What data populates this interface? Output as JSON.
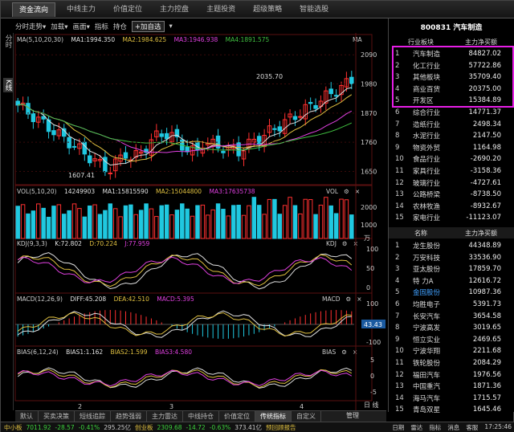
{
  "top_tabs": [
    "资金流向",
    "中线主力",
    "价值定位",
    "主力控盘",
    "主题投资",
    "超级策略",
    "智能选股"
  ],
  "active_top_tab": 0,
  "toolbar": {
    "items": [
      "分时走势▾",
      "加载▾",
      "画面▾",
      "指标",
      "持仓"
    ],
    "add_watch": "+加自选",
    "add_watch_arrow": "▾",
    "right_label": "MA"
  },
  "left_vertical": {
    "top": "分时",
    "middle": "K线"
  },
  "ma_legend": {
    "name": "MA(5,10,20,30)",
    "items": [
      {
        "label": "MA1:1994.350",
        "color": "#e0e0e0"
      },
      {
        "label": "MA2:1984.625",
        "color": "#e0c040"
      },
      {
        "label": "MA3:1946.938",
        "color": "#e040e0"
      },
      {
        "label": "MA4:1891.575",
        "color": "#40c040"
      }
    ]
  },
  "price_axis": {
    "labels": [
      "2090",
      "1980",
      "1870",
      "1760",
      "1650"
    ],
    "min": 1600,
    "max": 2130
  },
  "price_annotations": {
    "high": "2035.70",
    "low": "1607.41"
  },
  "vol_legend": {
    "name": "VOL(5,10,20)",
    "items": [
      {
        "label": "14249903",
        "color": "#e0e0e0"
      },
      {
        "label": "MA1:15815590",
        "color": "#e0e0e0"
      },
      {
        "label": "MA2:15044800",
        "color": "#e0c040"
      },
      {
        "label": "MA3:17635738",
        "color": "#e040e0"
      }
    ],
    "tag": "VOL"
  },
  "vol_axis": {
    "labels": [
      "2000",
      "1000"
    ],
    "unit": "万"
  },
  "kdj_legend": {
    "name": "KDJ(9,3,3)",
    "items": [
      {
        "label": "K:72.802",
        "color": "#e0e0e0"
      },
      {
        "label": "D:70.224",
        "color": "#e0c040"
      },
      {
        "label": "J:77.959",
        "color": "#e040e0"
      }
    ],
    "tag": "KDJ"
  },
  "kdj_axis": {
    "labels": [
      "100",
      "50",
      "0"
    ]
  },
  "macd_legend": {
    "name": "MACD(12,26,9)",
    "items": [
      {
        "label": "DIFF:45.208",
        "color": "#e0e0e0"
      },
      {
        "label": "DEA:42.510",
        "color": "#e0c040"
      },
      {
        "label": "MACD:5.395",
        "color": "#e040e0"
      }
    ],
    "tag": "MACD"
  },
  "macd_axis": {
    "labels": [
      "100",
      "-100"
    ],
    "badge": "43.43"
  },
  "bias_legend": {
    "name": "BIAS(6,12,24)",
    "items": [
      {
        "label": "BIAS1:1.162",
        "color": "#e0e0e0"
      },
      {
        "label": "BIAS2:1.599",
        "color": "#e0c040"
      },
      {
        "label": "BIAS3:4.580",
        "color": "#e040e0"
      }
    ],
    "tag": "BIAS"
  },
  "bias_axis": {
    "labels": [
      "5",
      "0",
      "-5"
    ]
  },
  "date_axis": [
    "2",
    "3",
    "4"
  ],
  "right_panel": {
    "title": "800831 汽车制造",
    "sector_headers": [
      "行业板块",
      "主力净买额"
    ],
    "sectors": [
      {
        "rank": "1",
        "name": "汽车制造",
        "value": "84827.02"
      },
      {
        "rank": "2",
        "name": "化工行业",
        "value": "57722.86"
      },
      {
        "rank": "3",
        "name": "其他板块",
        "value": "35709.40"
      },
      {
        "rank": "4",
        "name": "商业百货",
        "value": "20375.00"
      },
      {
        "rank": "5",
        "name": "开发区",
        "value": "15384.89"
      },
      {
        "rank": "6",
        "name": "综合行业",
        "value": "14771.37"
      },
      {
        "rank": "7",
        "name": "造纸行业",
        "value": "2498.34"
      },
      {
        "rank": "8",
        "name": "水泥行业",
        "value": "2147.50"
      },
      {
        "rank": "9",
        "name": "物资外贸",
        "value": "1164.98"
      },
      {
        "rank": "10",
        "name": "食品行业",
        "value": "-2690.20"
      },
      {
        "rank": "11",
        "name": "家具行业",
        "value": "-3158.36"
      },
      {
        "rank": "12",
        "name": "玻璃行业",
        "value": "-4727.61"
      },
      {
        "rank": "13",
        "name": "公路桥梁",
        "value": "-8738.50"
      },
      {
        "rank": "14",
        "name": "农林牧渔",
        "value": "-8932.67"
      },
      {
        "rank": "15",
        "name": "家电行业",
        "value": "-11123.07"
      }
    ],
    "stock_headers": [
      "名称",
      "主力净买额"
    ],
    "stocks": [
      {
        "rank": "1",
        "name": "龙生股份",
        "value": "44348.89"
      },
      {
        "rank": "2",
        "name": "万安科技",
        "value": "33536.90"
      },
      {
        "rank": "3",
        "name": "亚太股份",
        "value": "17859.70"
      },
      {
        "rank": "4",
        "name": "特 力A",
        "value": "12616.72"
      },
      {
        "rank": "5",
        "name": "金固股份",
        "value": "10987.36"
      },
      {
        "rank": "6",
        "name": "均胜电子",
        "value": "5391.73"
      },
      {
        "rank": "7",
        "name": "长安汽车",
        "value": "3654.58"
      },
      {
        "rank": "8",
        "name": "宁波高发",
        "value": "3019.65"
      },
      {
        "rank": "9",
        "name": "恒立实业",
        "value": "2469.65"
      },
      {
        "rank": "10",
        "name": "宁波华翔",
        "value": "2211.68"
      },
      {
        "rank": "11",
        "name": "铁轮股份",
        "value": "2084.29"
      },
      {
        "rank": "12",
        "name": "福田汽车",
        "value": "1976.56"
      },
      {
        "rank": "13",
        "name": "中国重汽",
        "value": "1871.36"
      },
      {
        "rank": "14",
        "name": "海马汽车",
        "value": "1715.57"
      },
      {
        "rank": "15",
        "name": "青岛双星",
        "value": "1645.46"
      }
    ],
    "bottom_tabs": [
      "日",
      "线"
    ]
  },
  "bottom_tabs": [
    "默认",
    "买卖决策",
    "短线追踪",
    "趋势强弱",
    "主力雷达",
    "中线持仓",
    "价值定位",
    "传统指标",
    "自定义"
  ],
  "active_bottom_tab": 7,
  "bottom_right": "管理",
  "status_bar": {
    "index1_name": "中小板",
    "index1_value": "7011.92",
    "index1_change": "-28.57",
    "index1_pct": "-0.41%",
    "index1_amount": "295.25亿",
    "index2_name": "创业板",
    "index2_value": "2309.68",
    "index2_change": "-14.72",
    "index2_pct": "-0.63%",
    "index2_amount": "373.41亿",
    "notice": "预回顾报告",
    "right_items": [
      "日期",
      "雷达",
      "指标",
      "消息",
      "客服"
    ],
    "time": "17:25:46"
  },
  "colors": {
    "up": "#ff3030",
    "down": "#20c8e0",
    "highlight": "#e61ee6"
  }
}
